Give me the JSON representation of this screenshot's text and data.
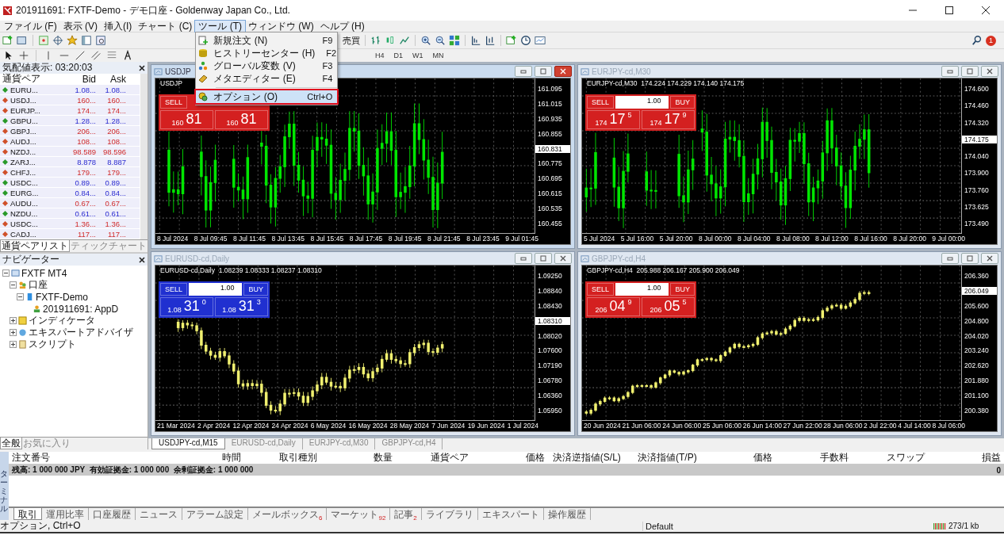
{
  "window": {
    "title": "201911691: FXTF-Demo - デモ口座 - Goldenway Japan Co., Ltd."
  },
  "menu": [
    {
      "label": "ファイル (F)",
      "selected": false
    },
    {
      "label": "表示 (V)",
      "selected": false
    },
    {
      "label": "挿入(I)",
      "selected": false
    },
    {
      "label": "チャート (C)",
      "selected": false
    },
    {
      "label": "ツール (T)",
      "selected": true
    },
    {
      "label": "ウィンドウ (W)",
      "selected": false
    },
    {
      "label": "ヘルプ (H)",
      "selected": false
    }
  ],
  "dropdown": [
    {
      "label": "新規注文 (N)",
      "shortcut": "F9",
      "selected": false,
      "kind": "order"
    },
    {
      "label": "ヒストリーセンター (H)",
      "shortcut": "F2",
      "selected": false,
      "kind": "history"
    },
    {
      "label": "グローバル変数 (V)",
      "shortcut": "F3",
      "selected": false,
      "kind": "globals"
    },
    {
      "label": "メタエディター (E)",
      "shortcut": "F4",
      "selected": false,
      "kind": "editor"
    },
    {
      "label": "オプション (O)",
      "shortcut": "Ctrl+O",
      "selected": true,
      "kind": "options"
    }
  ],
  "toolbar": {
    "label": "売買",
    "timeframes": [
      "H4",
      "D1",
      "W1",
      "MN"
    ],
    "notification_count": "1"
  },
  "market_watch": {
    "title": "気配値表示: 03:20:03",
    "columns": [
      "通貨ペア",
      "Bid",
      "Ask"
    ],
    "rows": [
      {
        "symbol": "EURU...",
        "bid": "1.08...",
        "ask": "1.08...",
        "kind": "up"
      },
      {
        "symbol": "USDJ...",
        "bid": "160...",
        "ask": "160...",
        "kind": "down"
      },
      {
        "symbol": "EURJP...",
        "bid": "174...",
        "ask": "174...",
        "kind": "down"
      },
      {
        "symbol": "GBPU...",
        "bid": "1.28...",
        "ask": "1.28...",
        "kind": "up"
      },
      {
        "symbol": "GBPJ...",
        "bid": "206...",
        "ask": "206...",
        "kind": "down"
      },
      {
        "symbol": "AUDJ...",
        "bid": "108...",
        "ask": "108...",
        "kind": "down"
      },
      {
        "symbol": "NZDJ...",
        "bid": "98.589",
        "ask": "98.596",
        "kind": "down"
      },
      {
        "symbol": "ZARJ...",
        "bid": "8.878",
        "ask": "8.887",
        "kind": "up"
      },
      {
        "symbol": "CHFJ...",
        "bid": "179...",
        "ask": "179...",
        "kind": "down"
      },
      {
        "symbol": "USDC...",
        "bid": "0.89...",
        "ask": "0.89...",
        "kind": "up"
      },
      {
        "symbol": "EURG...",
        "bid": "0.84...",
        "ask": "0.84...",
        "kind": "up"
      },
      {
        "symbol": "AUDU...",
        "bid": "0.67...",
        "ask": "0.67...",
        "kind": "down"
      },
      {
        "symbol": "NZDU...",
        "bid": "0.61...",
        "ask": "0.61...",
        "kind": "up"
      },
      {
        "symbol": "USDC...",
        "bid": "1.36...",
        "ask": "1.36...",
        "kind": "down"
      },
      {
        "symbol": "CADJ...",
        "bid": "117...",
        "ask": "117...",
        "kind": "down"
      }
    ],
    "tabs": [
      {
        "label": "通貨ペアリスト",
        "selected": true
      },
      {
        "label": "ティックチャート",
        "selected": false
      }
    ]
  },
  "navigator": {
    "title": "ナビゲーター",
    "tree": [
      {
        "label": "FXTF MT4",
        "kind": "root",
        "expanded": true,
        "children": [
          {
            "label": "口座",
            "kind": "accounts",
            "expanded": true,
            "children": [
              {
                "label": "FXTF-Demo",
                "kind": "server",
                "expanded": true,
                "children": [
                  {
                    "label": "201911691: AppD",
                    "kind": "account"
                  }
                ]
              }
            ]
          },
          {
            "label": "インディケータ",
            "kind": "indicators",
            "expanded": false
          },
          {
            "label": "エキスパートアドバイザ",
            "kind": "experts",
            "expanded": false
          },
          {
            "label": "スクリプト",
            "kind": "scripts",
            "expanded": false
          }
        ]
      }
    ],
    "tabs": [
      {
        "label": "全般",
        "selected": true
      },
      {
        "label": "お気に入り",
        "selected": false
      }
    ]
  },
  "charts": [
    {
      "title": "USDJP",
      "selected": true,
      "color": "#00e600",
      "info": "USDJP",
      "panel": {
        "color": "#d42020",
        "sell": "SELL",
        "bid_prefix": "160",
        "bid_big": "81",
        "ask_prefix": "160",
        "ask_big": "81"
      },
      "prices": [
        {
          "label": "161.095",
          "current": false
        },
        {
          "label": "161.015",
          "current": false
        },
        {
          "label": "160.935",
          "current": false
        },
        {
          "label": "160.855",
          "current": false
        },
        {
          "label": "160.831",
          "current": true
        },
        {
          "label": "160.775",
          "current": false
        },
        {
          "label": "160.695",
          "current": false
        },
        {
          "label": "160.615",
          "current": false
        },
        {
          "label": "160.535",
          "current": false
        },
        {
          "label": "160.455",
          "current": false
        }
      ],
      "times": [
        "8 Jul 2024",
        "8 Jul 09:45",
        "8 Jul 11:45",
        "8 Jul 13:45",
        "8 Jul 15:45",
        "8 Jul 17:45",
        "8 Jul 19:45",
        "8 Jul 21:45",
        "8 Jul 23:45",
        "9 Jul 01:45"
      ]
    },
    {
      "title": "EURJPY-cd,M30",
      "selected": false,
      "color": "#00e600",
      "info": "EURJPY-cd,M30  174.224 174.229 174.140 174.175",
      "panel": {
        "color": "#d42020",
        "sell": "SELL",
        "lot": "1.00",
        "buy": "BUY",
        "bid_prefix": "174",
        "bid_big": "17",
        "bid_pip": "5",
        "ask_prefix": "174",
        "ask_big": "17",
        "ask_pip": "9"
      },
      "prices": [
        {
          "label": "174.600",
          "current": false
        },
        {
          "label": "174.460",
          "current": false
        },
        {
          "label": "174.320",
          "current": false
        },
        {
          "label": "174.175",
          "current": true
        },
        {
          "label": "174.040",
          "current": false
        },
        {
          "label": "173.900",
          "current": false
        },
        {
          "label": "173.760",
          "current": false
        },
        {
          "label": "173.625",
          "current": false
        },
        {
          "label": "173.490",
          "current": false
        }
      ],
      "times": [
        "5 Jul 2024",
        "5 Jul 16:00",
        "5 Jul 20:00",
        "8 Jul 00:00",
        "8 Jul 04:00",
        "8 Jul 08:00",
        "8 Jul 12:00",
        "8 Jul 16:00",
        "8 Jul 20:00",
        "9 Jul 00:00"
      ]
    },
    {
      "title": "EURUSD-cd,Daily",
      "selected": false,
      "color": "#f0f070",
      "info": "EURUSD-cd,Daily  1.08239 1.08333 1.08237 1.08310",
      "panel": {
        "color": "#2030d0",
        "sell": "SELL",
        "lot": "1.00",
        "buy": "BUY",
        "bid_prefix": "1.08",
        "bid_big": "31",
        "bid_pip": "0",
        "ask_prefix": "1.08",
        "ask_big": "31",
        "ask_pip": "3"
      },
      "prices": [
        {
          "label": "1.09250",
          "current": false
        },
        {
          "label": "1.08840",
          "current": false
        },
        {
          "label": "1.08430",
          "current": false
        },
        {
          "label": "1.08310",
          "current": true
        },
        {
          "label": "1.08020",
          "current": false
        },
        {
          "label": "1.07600",
          "current": false
        },
        {
          "label": "1.07190",
          "current": false
        },
        {
          "label": "1.06780",
          "current": false
        },
        {
          "label": "1.06360",
          "current": false
        },
        {
          "label": "1.05950",
          "current": false
        }
      ],
      "times": [
        "21 Mar 2024",
        "2 Apr 2024",
        "12 Apr 2024",
        "24 Apr 2024",
        "6 May 2024",
        "16 May 2024",
        "28 May 2024",
        "7 Jun 2024",
        "19 Jun 2024",
        "1 Jul 2024"
      ]
    },
    {
      "title": "GBPJPY-cd,H4",
      "selected": false,
      "color": "#f0f070",
      "info": "GBPJPY-cd,H4  205.988 206.167 205.900 206.049",
      "panel": {
        "color": "#d42020",
        "sell": "SELL",
        "lot": "1.00",
        "buy": "BUY",
        "bid_prefix": "206",
        "bid_big": "04",
        "bid_pip": "9",
        "ask_prefix": "206",
        "ask_big": "05",
        "ask_pip": "5"
      },
      "prices": [
        {
          "label": "206.360",
          "current": false
        },
        {
          "label": "206.049",
          "current": true
        },
        {
          "label": "205.600",
          "current": false
        },
        {
          "label": "204.800",
          "current": false
        },
        {
          "label": "204.020",
          "current": false
        },
        {
          "label": "203.240",
          "current": false
        },
        {
          "label": "202.620",
          "current": false
        },
        {
          "label": "201.880",
          "current": false
        },
        {
          "label": "201.100",
          "current": false
        },
        {
          "label": "200.380",
          "current": false
        }
      ],
      "times": [
        "20 Jun 2024",
        "21 Jun 06:00",
        "24 Jun 06:00",
        "25 Jun 06:00",
        "26 Jun 14:00",
        "27 Jun 22:00",
        "28 Jun 06:00",
        "2 Jul 22:00",
        "4 Jul 14:00",
        "8 Jul 06:00"
      ]
    }
  ],
  "chart_tabs": [
    {
      "label": "USDJPY-cd,M15",
      "selected": true
    },
    {
      "label": "EURUSD-cd,Daily",
      "selected": false
    },
    {
      "label": "EURJPY-cd,M30",
      "selected": false
    },
    {
      "label": "GBPJPY-cd,H4",
      "selected": false
    }
  ],
  "terminal": {
    "side_label": "ターミナル",
    "columns": [
      "注文番号",
      "時間",
      "取引種別",
      "数量",
      "通貨ペア",
      "価格",
      "決済逆指値(S/L)",
      "決済指値(T/P)",
      "価格",
      "手数料",
      "スワップ",
      "損益"
    ],
    "balance": "残高: 1 000 000 JPY  有効証拠金: 1 000 000  余剰証拠金: 1 000 000",
    "profit": "0",
    "tabs": [
      {
        "label": "取引",
        "selected": true
      },
      {
        "label": "運用比率",
        "selected": false
      },
      {
        "label": "口座履歴",
        "selected": false
      },
      {
        "label": "ニュース",
        "selected": false
      },
      {
        "label": "アラーム設定",
        "selected": false
      },
      {
        "label": "メールボックス",
        "badge": "6",
        "selected": false
      },
      {
        "label": "マーケット",
        "badge": "92",
        "selected": false
      },
      {
        "label": "記事",
        "badge": "2",
        "selected": false
      },
      {
        "label": "ライブラリ",
        "selected": false
      },
      {
        "label": "エキスパート",
        "selected": false
      },
      {
        "label": "操作履歴",
        "selected": false
      }
    ]
  },
  "status_bar": {
    "hint": "オプション, Ctrl+O",
    "profile": "Default",
    "traffic": "273/1 kb"
  }
}
